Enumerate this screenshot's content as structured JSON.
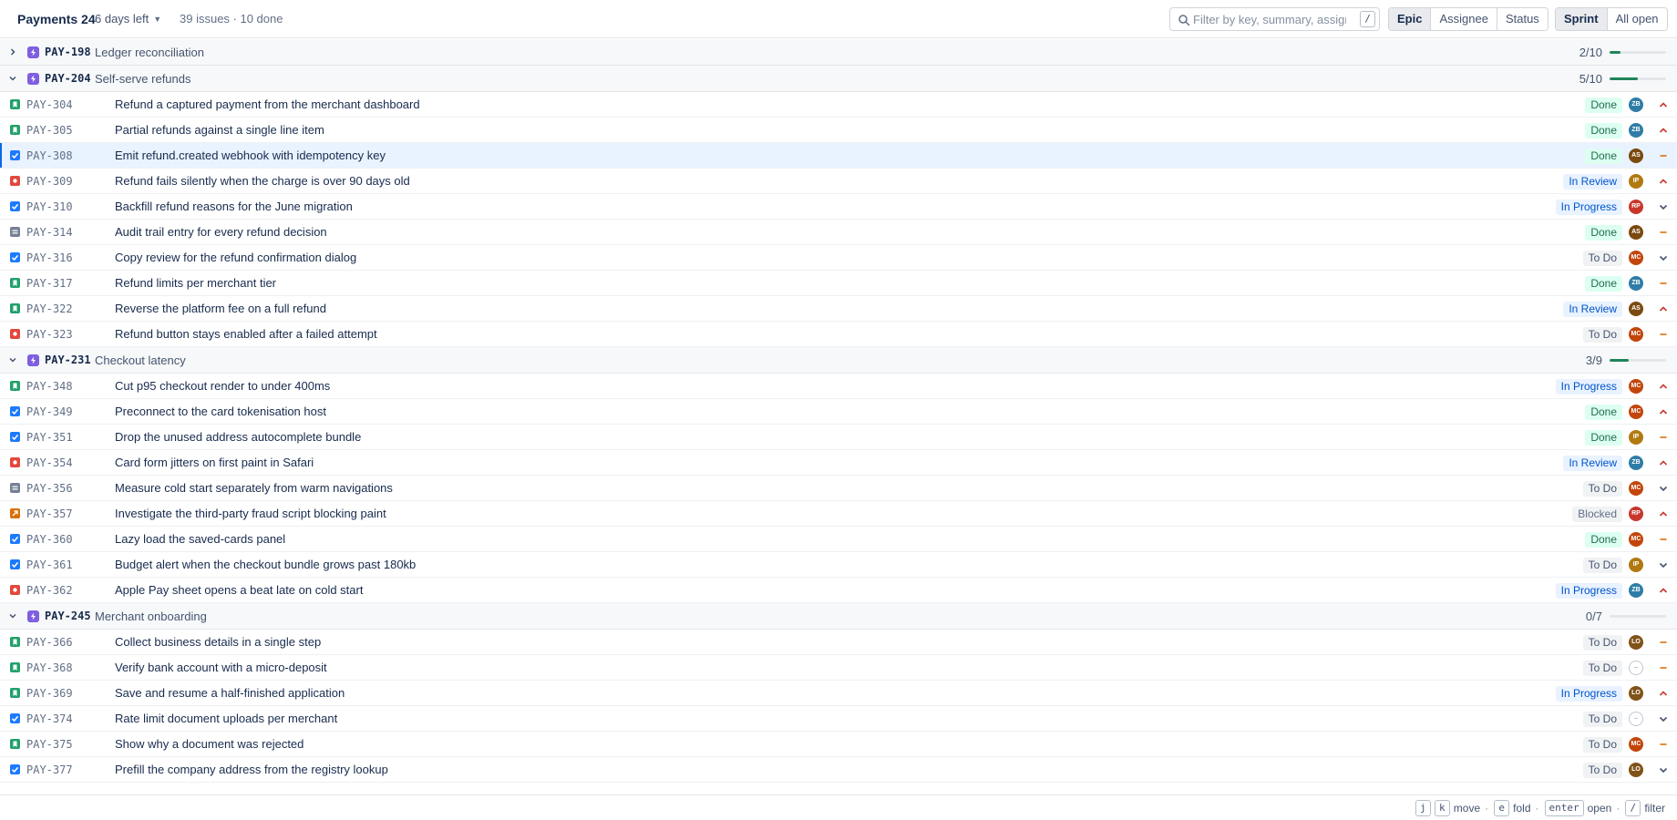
{
  "header": {
    "sprint_name": "Payments 24",
    "days_left": "6 days left",
    "summary": "39 issues · 10 done",
    "filter_placeholder": "Filter by key, summary, assignee",
    "filter_shortcut": "/",
    "group_by": [
      "Epic",
      "Assignee",
      "Status"
    ],
    "group_by_active": "Epic",
    "scope": [
      "Sprint",
      "All open"
    ],
    "scope_active": "Sprint"
  },
  "colors": {
    "accent": "#0c66e4",
    "epic_icon": "#7f5fe0",
    "progress_fill": "#1f845a",
    "selected_row": "#e9f2ff",
    "priority_high": "#c9372c",
    "priority_medium": "#d97008",
    "priority_low": "#44546f"
  },
  "avatars": {
    "ZB": "#2f7da6",
    "AS": "#7a4a10",
    "IP": "#b07a10",
    "RP": "#c9372c",
    "MC": "#c2460c",
    "LO": "#805318"
  },
  "epics": [
    {
      "key": "PAY-198",
      "title": "Ledger reconciliation",
      "count": "2/10",
      "done": 2,
      "total": 10,
      "expanded": false,
      "issues": []
    },
    {
      "key": "PAY-204",
      "title": "Self-serve refunds",
      "count": "5/10",
      "done": 5,
      "total": 10,
      "expanded": true,
      "issues": [
        {
          "key": "PAY-304",
          "title": "Refund a captured payment from the merchant dashboard",
          "type": "story",
          "status": "Done",
          "assignee": "ZB",
          "priority": "high"
        },
        {
          "key": "PAY-305",
          "title": "Partial refunds against a single line item",
          "type": "story",
          "status": "Done",
          "assignee": "ZB",
          "priority": "high"
        },
        {
          "key": "PAY-308",
          "title": "Emit refund.created webhook with idempotency key",
          "type": "task",
          "status": "Done",
          "assignee": "AS",
          "priority": "medium",
          "selected": true
        },
        {
          "key": "PAY-309",
          "title": "Refund fails silently when the charge is over 90 days old",
          "type": "bug",
          "status": "In Review",
          "assignee": "IP",
          "priority": "high"
        },
        {
          "key": "PAY-310",
          "title": "Backfill refund reasons for the June migration",
          "type": "task",
          "status": "In Progress",
          "assignee": "RP",
          "priority": "low"
        },
        {
          "key": "PAY-314",
          "title": "Audit trail entry for every refund decision",
          "type": "subtask",
          "status": "Done",
          "assignee": "AS",
          "priority": "medium"
        },
        {
          "key": "PAY-316",
          "title": "Copy review for the refund confirmation dialog",
          "type": "task",
          "status": "To Do",
          "assignee": "MC",
          "priority": "low"
        },
        {
          "key": "PAY-317",
          "title": "Refund limits per merchant tier",
          "type": "story",
          "status": "Done",
          "assignee": "ZB",
          "priority": "medium"
        },
        {
          "key": "PAY-322",
          "title": "Reverse the platform fee on a full refund",
          "type": "story",
          "status": "In Review",
          "assignee": "AS",
          "priority": "high"
        },
        {
          "key": "PAY-323",
          "title": "Refund button stays enabled after a failed attempt",
          "type": "bug",
          "status": "To Do",
          "assignee": "MC",
          "priority": "medium"
        }
      ]
    },
    {
      "key": "PAY-231",
      "title": "Checkout latency",
      "count": "3/9",
      "done": 3,
      "total": 9,
      "expanded": true,
      "issues": [
        {
          "key": "PAY-348",
          "title": "Cut p95 checkout render to under 400ms",
          "type": "story",
          "status": "In Progress",
          "assignee": "MC",
          "priority": "high"
        },
        {
          "key": "PAY-349",
          "title": "Preconnect to the card tokenisation host",
          "type": "task",
          "status": "Done",
          "assignee": "MC",
          "priority": "high"
        },
        {
          "key": "PAY-351",
          "title": "Drop the unused address autocomplete bundle",
          "type": "task",
          "status": "Done",
          "assignee": "IP",
          "priority": "medium"
        },
        {
          "key": "PAY-354",
          "title": "Card form jitters on first paint in Safari",
          "type": "bug",
          "status": "In Review",
          "assignee": "ZB",
          "priority": "high"
        },
        {
          "key": "PAY-356",
          "title": "Measure cold start separately from warm navigations",
          "type": "subtask",
          "status": "To Do",
          "assignee": "MC",
          "priority": "low"
        },
        {
          "key": "PAY-357",
          "title": "Investigate the third-party fraud script blocking paint",
          "type": "improvement",
          "status": "Blocked",
          "assignee": "RP",
          "priority": "high"
        },
        {
          "key": "PAY-360",
          "title": "Lazy load the saved-cards panel",
          "type": "task",
          "status": "Done",
          "assignee": "MC",
          "priority": "medium"
        },
        {
          "key": "PAY-361",
          "title": "Budget alert when the checkout bundle grows past 180kb",
          "type": "task",
          "status": "To Do",
          "assignee": "IP",
          "priority": "low"
        },
        {
          "key": "PAY-362",
          "title": "Apple Pay sheet opens a beat late on cold start",
          "type": "bug",
          "status": "In Progress",
          "assignee": "ZB",
          "priority": "high"
        }
      ]
    },
    {
      "key": "PAY-245",
      "title": "Merchant onboarding",
      "count": "0/7",
      "done": 0,
      "total": 7,
      "expanded": true,
      "issues": [
        {
          "key": "PAY-366",
          "title": "Collect business details in a single step",
          "type": "story",
          "status": "To Do",
          "assignee": "LO",
          "priority": "medium"
        },
        {
          "key": "PAY-368",
          "title": "Verify bank account with a micro-deposit",
          "type": "story",
          "status": "To Do",
          "assignee": "",
          "priority": "medium"
        },
        {
          "key": "PAY-369",
          "title": "Save and resume a half-finished application",
          "type": "story",
          "status": "In Progress",
          "assignee": "LO",
          "priority": "high"
        },
        {
          "key": "PAY-374",
          "title": "Rate limit document uploads per merchant",
          "type": "task",
          "status": "To Do",
          "assignee": "",
          "priority": "low"
        },
        {
          "key": "PAY-375",
          "title": "Show why a document was rejected",
          "type": "story",
          "status": "To Do",
          "assignee": "MC",
          "priority": "medium"
        },
        {
          "key": "PAY-377",
          "title": "Prefill the company address from the registry lookup",
          "type": "task",
          "status": "To Do",
          "assignee": "LO",
          "priority": "low"
        }
      ]
    }
  ],
  "unassigned_label": "–",
  "footer": {
    "hints": [
      {
        "keys": [
          "j",
          "k"
        ],
        "label": "move"
      },
      {
        "keys": [
          "e"
        ],
        "label": "fold"
      },
      {
        "keys": [
          "enter"
        ],
        "label": "open"
      },
      {
        "keys": [
          "/"
        ],
        "label": "filter"
      }
    ],
    "separator": "·"
  }
}
